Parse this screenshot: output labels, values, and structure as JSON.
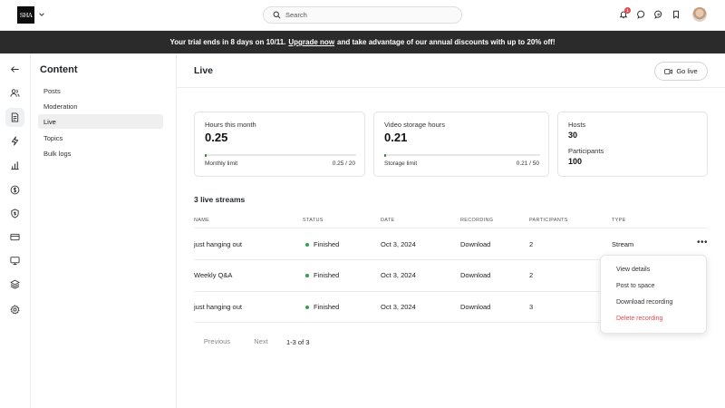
{
  "logo": {
    "text": "SHA"
  },
  "search": {
    "placeholder": "Search"
  },
  "notifications": {
    "count": "1"
  },
  "banner": {
    "prefix": "Your trial ends in 8 days on 10/11.",
    "link": "Upgrade now",
    "suffix": "and take advantage of our annual discounts with up to 20% off!"
  },
  "rail": {
    "icons": [
      "back-arrow-icon",
      "people-icon",
      "document-icon",
      "bolt-icon",
      "bar-chart-icon",
      "dollar-icon",
      "shield-dollar-icon",
      "credit-card-icon",
      "monitor-icon",
      "layers-icon",
      "gear-icon"
    ]
  },
  "subnav": {
    "title": "Content",
    "items": [
      {
        "label": "Posts",
        "active": false
      },
      {
        "label": "Moderation",
        "active": false
      },
      {
        "label": "Live",
        "active": true
      },
      {
        "label": "Topics",
        "active": false
      },
      {
        "label": "Bulk logs",
        "active": false
      }
    ]
  },
  "page": {
    "title": "Live",
    "go_live_label": "Go live"
  },
  "cards": {
    "hours": {
      "label": "Hours this month",
      "value": "0.25",
      "limit_label": "Monthly limit",
      "limit_value": "0.25 / 20",
      "progress": 0.0125
    },
    "storage": {
      "label": "Video storage hours",
      "value": "0.21",
      "limit_label": "Storage limit",
      "limit_value": "0.21 / 50",
      "progress": 0.0042
    },
    "stats": {
      "hosts_label": "Hosts",
      "hosts_value": "30",
      "participants_label": "Participants",
      "participants_value": "100"
    }
  },
  "streams": {
    "title": "3 live streams",
    "columns": [
      "NAME",
      "STATUS",
      "DATE",
      "RECORDING",
      "PARTICIPANTS",
      "TYPE"
    ],
    "rows": [
      {
        "name": "just hanging out",
        "status": "Finished",
        "date": "Oct 3, 2024",
        "recording": "Download",
        "participants": "2",
        "type": "Stream"
      },
      {
        "name": "Weekly Q&A",
        "status": "Finished",
        "date": "Oct 3, 2024",
        "recording": "Download",
        "participants": "2",
        "type": ""
      },
      {
        "name": "just hanging out",
        "status": "Finished",
        "date": "Oct 3, 2024",
        "recording": "Download",
        "participants": "3",
        "type": ""
      }
    ],
    "more_label": "•••"
  },
  "row_menu": {
    "items": [
      "View details",
      "Post to space",
      "Download recording",
      "Delete recording"
    ]
  },
  "pagination": {
    "previous": "Previous",
    "next": "Next",
    "count": "1-3 of 3"
  },
  "colors": {
    "accent_green": "#1a7f37",
    "status_green": "#2da44e",
    "danger": "#e5484d",
    "banner_bg": "#2b2b2b"
  }
}
